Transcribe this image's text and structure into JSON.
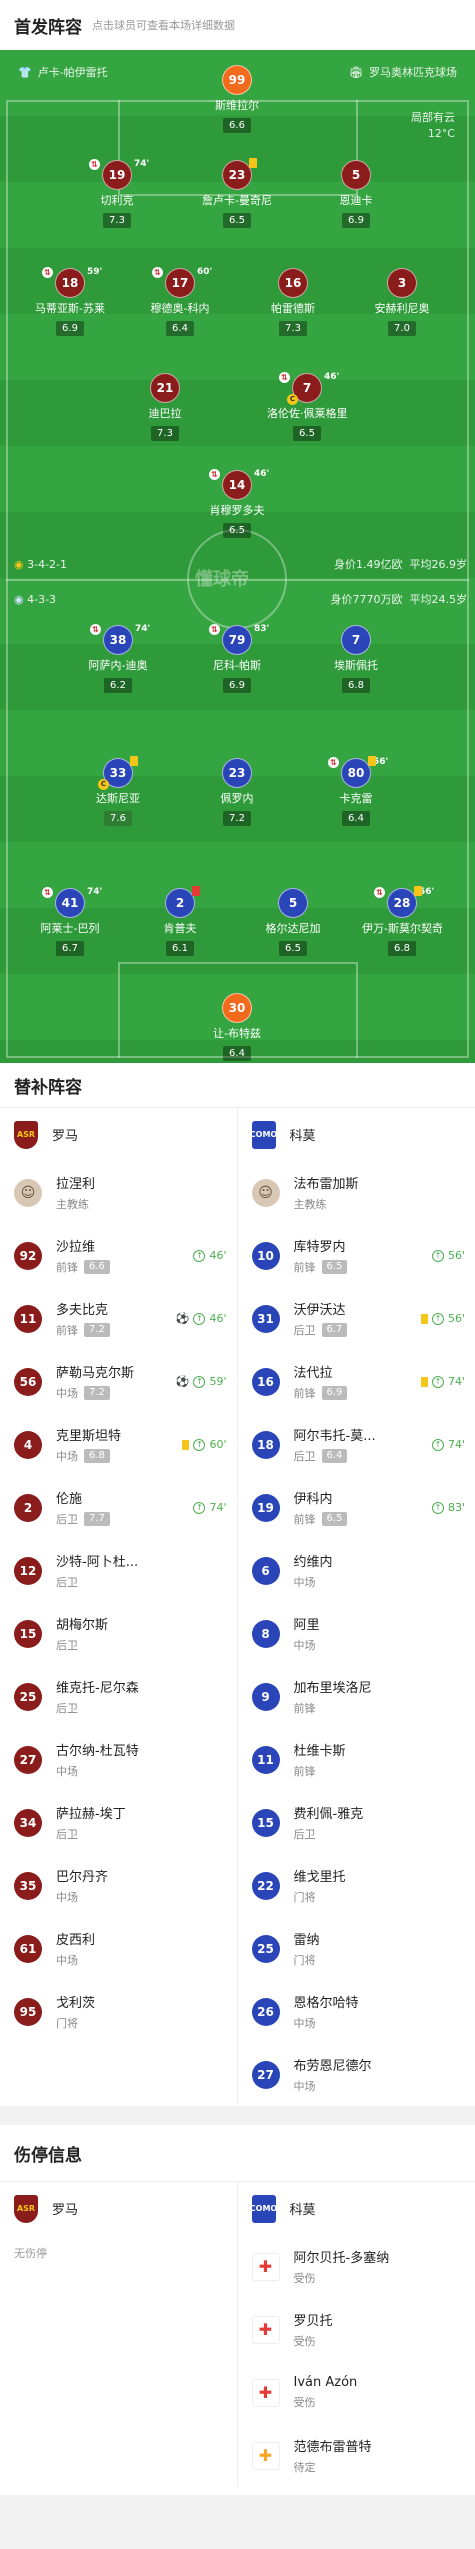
{
  "header": {
    "title": "首发阵容",
    "subtitle": "点击球员可查看本场详细数据"
  },
  "pitch": {
    "home_team": "卢卡-帕伊雷托",
    "away_team": "罗马奥林匹克球场",
    "weather_line1": "局部有云",
    "weather_line2": "12°C",
    "watermark": "懂球帝",
    "home_formation": "3-4-2-1",
    "home_value": "身价1.49亿欧",
    "home_age": "平均26.9岁",
    "away_formation": "4-3-3",
    "away_value": "身价7770万欧",
    "away_age": "平均24.5岁",
    "players": [
      {
        "num": "99",
        "name": "斯维拉尔",
        "rating": "6.6",
        "team": "home",
        "gk": true
      },
      {
        "num": "19",
        "name": "切利克",
        "rating": "7.3",
        "team": "home",
        "sub": "74'"
      },
      {
        "num": "23",
        "name": "詹卢卡-曼奇尼",
        "rating": "6.5",
        "team": "home",
        "yc": true
      },
      {
        "num": "5",
        "name": "恩迪卡",
        "rating": "6.9",
        "team": "home"
      },
      {
        "num": "18",
        "name": "马蒂亚斯-苏莱",
        "rating": "6.9",
        "team": "home",
        "sub": "59'"
      },
      {
        "num": "17",
        "name": "穆德奥-科内",
        "rating": "6.4",
        "team": "home",
        "sub": "60'"
      },
      {
        "num": "16",
        "name": "帕雷德斯",
        "rating": "7.3",
        "team": "home"
      },
      {
        "num": "3",
        "name": "安赫利尼奥",
        "rating": "7.0",
        "team": "home"
      },
      {
        "num": "21",
        "name": "迪巴拉",
        "rating": "7.3",
        "team": "home"
      },
      {
        "num": "7",
        "name": "洛伦佐·佩莱格里尼",
        "rating": "6.5",
        "team": "home",
        "sub": "46'",
        "cap": true
      },
      {
        "num": "14",
        "name": "肖穆罗多夫",
        "rating": "6.5",
        "team": "home",
        "sub": "46'"
      },
      {
        "num": "38",
        "name": "阿萨内-迪奥",
        "rating": "6.2",
        "team": "away",
        "sub": "74'"
      },
      {
        "num": "79",
        "name": "尼科-帕斯",
        "rating": "6.9",
        "team": "away",
        "sub": "83'"
      },
      {
        "num": "7",
        "name": "埃斯佩托",
        "rating": "6.8",
        "team": "away"
      },
      {
        "num": "33",
        "name": "达斯尼亚",
        "rating": "7.6",
        "team": "away",
        "yc": true,
        "cap": true
      },
      {
        "num": "23",
        "name": "佩罗内",
        "rating": "7.2",
        "team": "away"
      },
      {
        "num": "80",
        "name": "卡克雷",
        "rating": "6.4",
        "team": "away",
        "sub": "56'",
        "yc": true
      },
      {
        "num": "41",
        "name": "阿莱士-巴列",
        "rating": "6.7",
        "team": "away",
        "sub": "74'"
      },
      {
        "num": "2",
        "name": "肯普夫",
        "rating": "6.1",
        "team": "away",
        "rc": true
      },
      {
        "num": "5",
        "name": "格尔达尼加",
        "rating": "6.5",
        "team": "away"
      },
      {
        "num": "28",
        "name": "伊万-斯莫尔契奇",
        "rating": "6.8",
        "team": "away",
        "sub": "56'",
        "yc": true
      },
      {
        "num": "30",
        "name": "让-布特兹",
        "rating": "6.4",
        "team": "away",
        "gk": true
      }
    ]
  },
  "subs": {
    "title": "替补阵容",
    "home_team": "罗马",
    "away_team": "科莫",
    "home_coach": {
      "name": "拉涅利",
      "role": "主教练"
    },
    "away_coach": {
      "name": "法布雷加斯",
      "role": "主教练"
    },
    "home": [
      {
        "num": "92",
        "name": "沙拉维",
        "pos": "前锋",
        "rating": "6.6",
        "ev": "46'"
      },
      {
        "num": "11",
        "name": "多夫比克",
        "pos": "前锋",
        "rating": "7.2",
        "ev": "46'",
        "goal": true
      },
      {
        "num": "56",
        "name": "萨勒马克尔斯",
        "pos": "中场",
        "rating": "7.2",
        "ev": "59'",
        "goal": true
      },
      {
        "num": "4",
        "name": "克里斯坦特",
        "pos": "中场",
        "rating": "6.8",
        "ev": "60'",
        "ycard": true
      },
      {
        "num": "2",
        "name": "伦施",
        "pos": "后卫",
        "rating": "7.7",
        "ev": "74'"
      },
      {
        "num": "12",
        "name": "沙特-阿卜杜...",
        "pos": "后卫"
      },
      {
        "num": "15",
        "name": "胡梅尔斯",
        "pos": "后卫"
      },
      {
        "num": "25",
        "name": "维克托-尼尔森",
        "pos": "后卫"
      },
      {
        "num": "27",
        "name": "古尔纳-杜瓦特",
        "pos": "中场"
      },
      {
        "num": "34",
        "name": "萨拉赫-埃丁",
        "pos": "后卫"
      },
      {
        "num": "35",
        "name": "巴尔丹齐",
        "pos": "中场"
      },
      {
        "num": "61",
        "name": "皮西利",
        "pos": "中场"
      },
      {
        "num": "95",
        "name": "戈利茨",
        "pos": "门将"
      }
    ],
    "away": [
      {
        "num": "10",
        "name": "库特罗内",
        "pos": "前锋",
        "rating": "6.5",
        "ev": "56'"
      },
      {
        "num": "31",
        "name": "沃伊沃达",
        "pos": "后卫",
        "rating": "6.7",
        "ev": "56'",
        "ycard": true
      },
      {
        "num": "16",
        "name": "法代拉",
        "pos": "前锋",
        "rating": "6.9",
        "ev": "74'",
        "ycard": true
      },
      {
        "num": "18",
        "name": "阿尔韦托-莫...",
        "pos": "后卫",
        "rating": "6.4",
        "ev": "74'"
      },
      {
        "num": "19",
        "name": "伊科内",
        "pos": "前锋",
        "rating": "6.5",
        "ev": "83'"
      },
      {
        "num": "6",
        "name": "约维内",
        "pos": "中场"
      },
      {
        "num": "8",
        "name": "阿里",
        "pos": "中场"
      },
      {
        "num": "9",
        "name": "加布里埃洛尼",
        "pos": "前锋"
      },
      {
        "num": "11",
        "name": "杜维卡斯",
        "pos": "前锋"
      },
      {
        "num": "15",
        "name": "费利佩-雅克",
        "pos": "后卫"
      },
      {
        "num": "22",
        "name": "维戈里托",
        "pos": "门将"
      },
      {
        "num": "25",
        "name": "雷纳",
        "pos": "门将"
      },
      {
        "num": "26",
        "name": "恩格尔哈特",
        "pos": "中场"
      },
      {
        "num": "27",
        "name": "布劳恩尼德尔",
        "pos": "中场"
      }
    ]
  },
  "injuries": {
    "title": "伤停信息",
    "home_team": "罗马",
    "away_team": "科莫",
    "home_none": "无伤停",
    "away": [
      {
        "name": "阿尔贝托-多塞纳",
        "status": "受伤",
        "type": "red"
      },
      {
        "name": "罗贝托",
        "status": "受伤",
        "type": "red"
      },
      {
        "name": "Iván Azón",
        "status": "受伤",
        "type": "red"
      },
      {
        "name": "范德布雷普特",
        "status": "待定",
        "type": "yel"
      }
    ]
  }
}
